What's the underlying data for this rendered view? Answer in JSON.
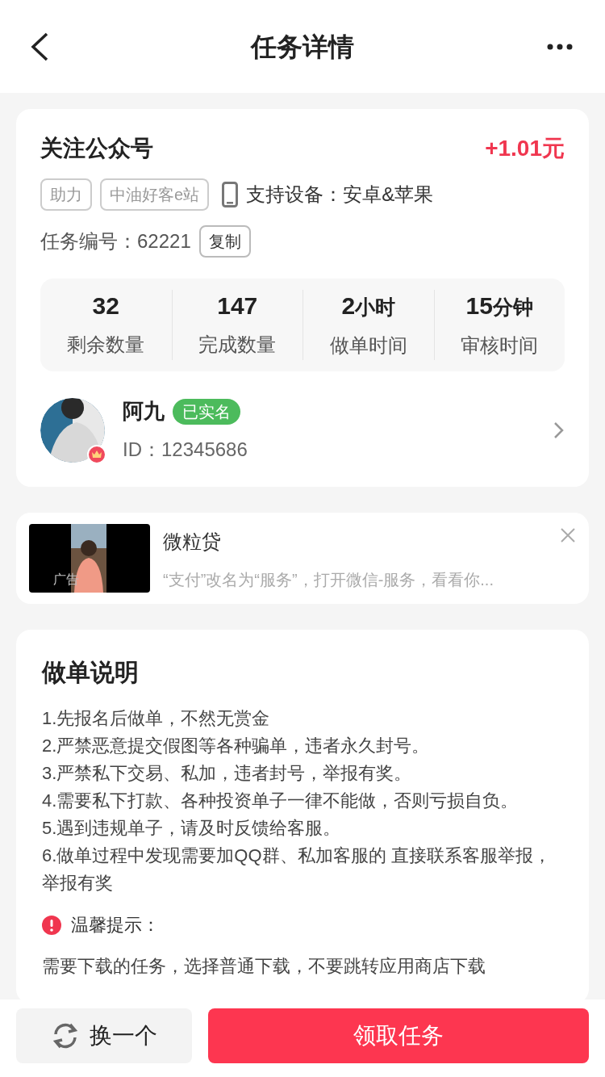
{
  "header": {
    "title": "任务详情"
  },
  "task": {
    "title": "关注公众号",
    "reward": "+1.01元",
    "tags": [
      "助力",
      "中油好客e站"
    ],
    "devices": "支持设备：安卓&苹果",
    "number_label": "任务编号：62221",
    "copy_button": "复制",
    "stats": [
      {
        "value": "32",
        "label": "剩余数量"
      },
      {
        "value": "147",
        "label": "完成数量"
      },
      {
        "value": "2",
        "unit": "小时",
        "label": "做单时间"
      },
      {
        "value": "15",
        "unit": "分钟",
        "label": "审核时间"
      }
    ]
  },
  "publisher": {
    "name": "阿九",
    "badge": "已实名",
    "id": "ID：12345686"
  },
  "ad": {
    "ad_label": "广告",
    "title": "微粒贷",
    "description": "“支付”改名为“服务”，打开微信-服务，看看你..."
  },
  "instructions": {
    "title": "做单说明",
    "lines": [
      "1.先报名后做单，不然无赏金",
      "2.严禁恶意提交假图等各种骗单，违者永久封号。",
      "3.严禁私下交易、私加，违者封号，举报有奖。",
      "4.需要私下打款、各种投资单子一律不能做，否则亏损自负。",
      "5.遇到违规单子，请及时反馈给客服。",
      "6.做单过程中发现需要加QQ群、私加客服的 直接联系客服举报，举报有奖"
    ],
    "tip_title": "温馨提示：",
    "tip_text": "需要下载的任务，选择普通下载，不要跳转应用商店下载"
  },
  "bottom_bar": {
    "switch_button": "换一个",
    "accept_button": "领取任务"
  }
}
